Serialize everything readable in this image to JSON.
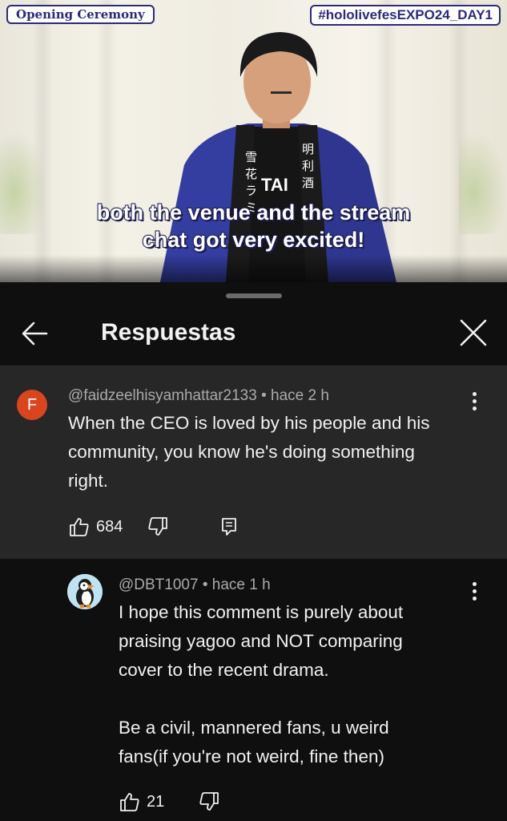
{
  "video": {
    "badge_left": "Opening Ceremony",
    "badge_right": "#hololivefesEXPO24_DAY1",
    "subtitle_line1": "both the venue and the stream",
    "subtitle_line2": "chat got very excited!",
    "shirt_text": "TAI"
  },
  "sheet": {
    "title": "Respuestas",
    "back_icon": "arrow-left-icon",
    "close_icon": "close-icon"
  },
  "parent_comment": {
    "avatar_letter": "F",
    "avatar_color": "#d9451e",
    "author": "@faidzeelhisyamhattar2133",
    "time": "• hace 2 h",
    "text_lines": [
      "When the CEO is loved by his people and his",
      "community, you know he's doing something",
      "right."
    ],
    "likes": "684"
  },
  "reply": {
    "author": "@DBT1007",
    "time": "• hace 1 h",
    "text_lines": [
      "I hope this comment is purely about",
      "praising yagoo and NOT comparing",
      "cover to the recent drama.",
      "",
      "Be a civil, mannered fans, u weird",
      "fans(if you're not weird, fine then)"
    ],
    "likes": "21"
  },
  "colors": {
    "background": "#0f0f0f",
    "highlight_bg": "#272727",
    "text_primary": "#f1f1f1",
    "text_secondary": "#aaaaaa",
    "badge_border": "#2a2a7a"
  }
}
